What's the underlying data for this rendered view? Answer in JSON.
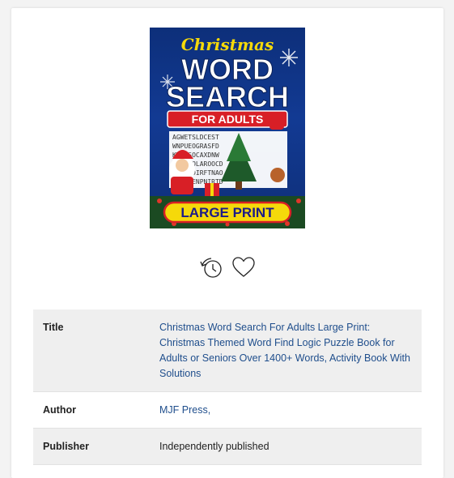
{
  "book": {
    "cover": {
      "script_title": "Christmas",
      "line1": "WORD",
      "line2": "SEARCH",
      "banner": "FOR ADULTS",
      "footer": "LARGE PRINT",
      "grid_rows": [
        "AGWETSLDCEST",
        "WNPUEOGRASFD",
        "KWELSOCAXDNW",
        "SMONSOLAROOCD",
        "QRTWIDIRFTNAO",
        "JMCUKENPNIRTD"
      ]
    },
    "details": [
      {
        "label": "Title",
        "value": "Christmas Word Search For Adults Large Print: Christmas Themed Word Find Logic Puzzle Book for Adults or Seniors Over 1400+ Words, Activity Book With Solutions",
        "link": true
      },
      {
        "label": "Author",
        "value": "MJF Press,",
        "link": true
      },
      {
        "label": "Publisher",
        "value": "Independently published",
        "link": false
      }
    ]
  },
  "actions": {
    "history_icon": "history-clock-icon",
    "wishlist_icon": "heart-icon"
  },
  "colors": {
    "link": "#1f4e8c",
    "row_shade": "#efefef",
    "cover_blue": "#123a93",
    "cover_red": "#d81f26",
    "cover_yellow": "#f5d90a"
  }
}
